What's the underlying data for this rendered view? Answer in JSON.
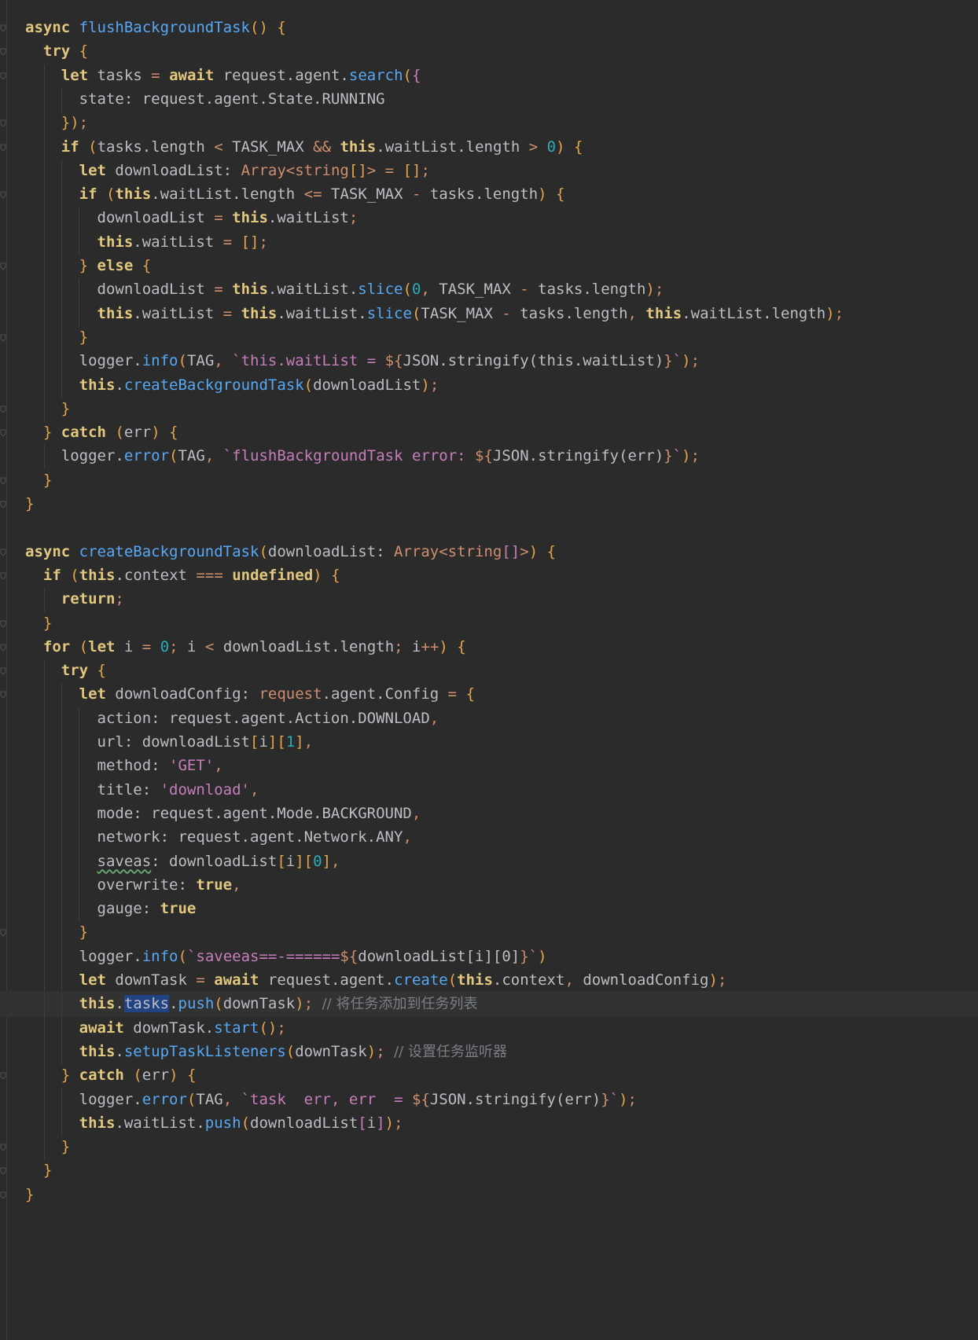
{
  "editor": {
    "language": "ArkTS",
    "selected_word": "tasks",
    "current_line": 42,
    "colors": {
      "background": "#2b2b2b",
      "keyword": "#cf8e6d",
      "function": "#56a8f5",
      "string": "#c77dbb",
      "number": "#2aacb8",
      "comment": "#7a7e85"
    },
    "lines": [
      "async flushBackgroundTask() {",
      "  try {",
      "    let tasks = await request.agent.search({",
      "      state: request.agent.State.RUNNING",
      "    });",
      "    if (tasks.length < TASK_MAX && this.waitList.length > 0) {",
      "      let downloadList: Array<string[]> = [];",
      "      if (this.waitList.length <= TASK_MAX - tasks.length) {",
      "        downloadList = this.waitList;",
      "        this.waitList = [];",
      "      } else {",
      "        downloadList = this.waitList.slice(0, TASK_MAX - tasks.length);",
      "        this.waitList = this.waitList.slice(TASK_MAX - tasks.length, this.waitList.length);",
      "      }",
      "      logger.info(TAG, `this.waitList = ${JSON.stringify(this.waitList)}`);",
      "      this.createBackgroundTask(downloadList);",
      "    }",
      "  } catch (err) {",
      "    logger.error(TAG, `flushBackgroundTask error: ${JSON.stringify(err)}`);",
      "  }",
      "}",
      "",
      "async createBackgroundTask(downloadList: Array<string[]>) {",
      "  if (this.context === undefined) {",
      "    return;",
      "  }",
      "  for (let i = 0; i < downloadList.length; i++) {",
      "    try {",
      "      let downloadConfig: request.agent.Config = {",
      "        action: request.agent.Action.DOWNLOAD,",
      "        url: downloadList[i][1],",
      "        method: 'GET',",
      "        title: 'download',",
      "        mode: request.agent.Mode.BACKGROUND,",
      "        network: request.agent.Network.ANY,",
      "        saveas: downloadList[i][0],",
      "        overwrite: true,",
      "        gauge: true",
      "      }",
      "      logger.info(`saveeas==-======${downloadList[i][0]}`)",
      "      let downTask = await request.agent.create(this.context, downloadConfig);",
      "      this.tasks.push(downTask); // 将任务添加到任务列表",
      "      await downTask.start();",
      "      this.setupTaskListeners(downTask); // 设置任务监听器",
      "    } catch (err) {",
      "      logger.error(TAG, `task  err, err  = ${JSON.stringify(err)}`);",
      "      this.waitList.push(downloadList[i]);",
      "    }",
      "  }",
      "}"
    ]
  }
}
